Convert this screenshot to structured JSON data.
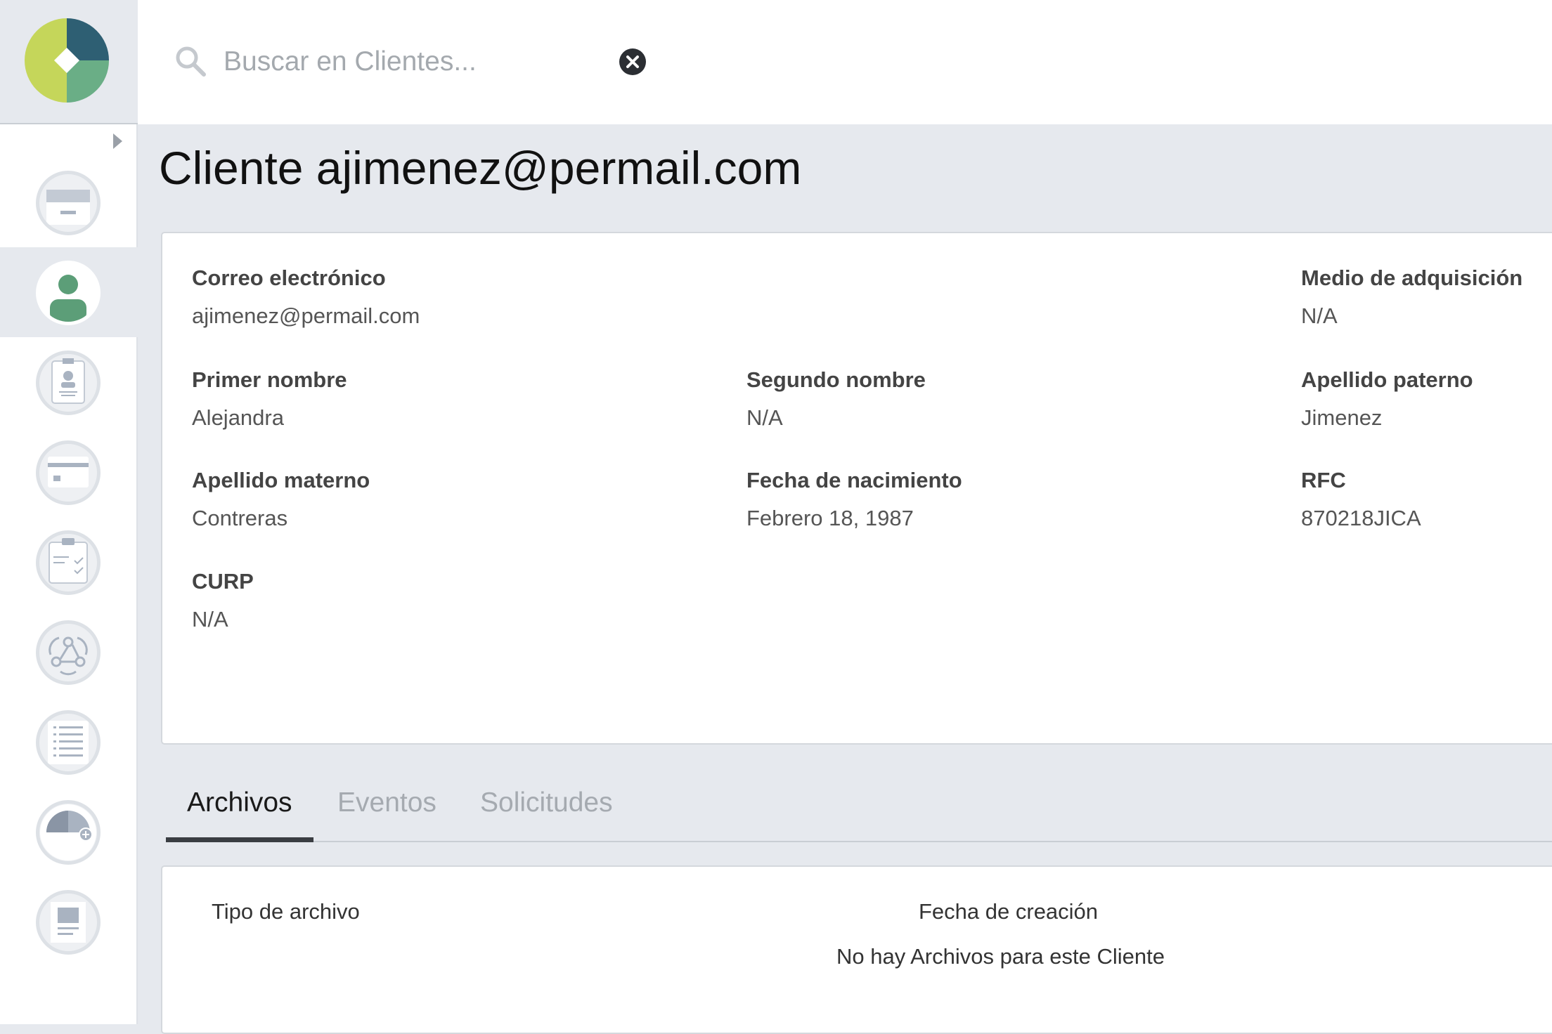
{
  "search": {
    "placeholder": "Buscar en Clientes..."
  },
  "page": {
    "title": "Cliente ajimenez@permail.com"
  },
  "sidebar": {
    "items": [
      {
        "icon": "card-reader-icon",
        "active": false
      },
      {
        "icon": "user-icon",
        "active": true
      },
      {
        "icon": "id-badge-icon",
        "active": false
      },
      {
        "icon": "credit-card-icon",
        "active": false
      },
      {
        "icon": "clipboard-checklist-icon",
        "active": false
      },
      {
        "icon": "webhook-icon",
        "active": false
      },
      {
        "icon": "list-icon",
        "active": false
      },
      {
        "icon": "gauge-add-icon",
        "active": false
      },
      {
        "icon": "document-icon",
        "active": false
      }
    ]
  },
  "fields": {
    "email": {
      "label": "Correo electrónico",
      "value": "ajimenez@permail.com"
    },
    "acquisition": {
      "label": "Medio de adquisición",
      "value": "N/A"
    },
    "first_name": {
      "label": "Primer nombre",
      "value": "Alejandra"
    },
    "middle_name": {
      "label": "Segundo nombre",
      "value": "N/A"
    },
    "paternal": {
      "label": "Apellido paterno",
      "value": "Jimenez"
    },
    "maternal": {
      "label": "Apellido materno",
      "value": "Contreras"
    },
    "birthdate": {
      "label": "Fecha de nacimiento",
      "value": "Febrero 18, 1987"
    },
    "rfc": {
      "label": "RFC",
      "value": "870218JICA"
    },
    "curp": {
      "label": "CURP",
      "value": "N/A"
    }
  },
  "tabs": [
    {
      "label": "Archivos",
      "active": true
    },
    {
      "label": "Eventos",
      "active": false
    },
    {
      "label": "Solicitudes",
      "active": false
    }
  ],
  "files": {
    "columns": [
      "Tipo de archivo",
      "Fecha de creación"
    ],
    "empty_message": "No hay Archivos para este Cliente"
  },
  "colors": {
    "logo_green_light": "#c5d65a",
    "logo_teal_dark": "#2e5f73",
    "logo_green": "#6aae86",
    "user_green": "#5c9e78",
    "icon_gray": "#a9b3c1"
  }
}
